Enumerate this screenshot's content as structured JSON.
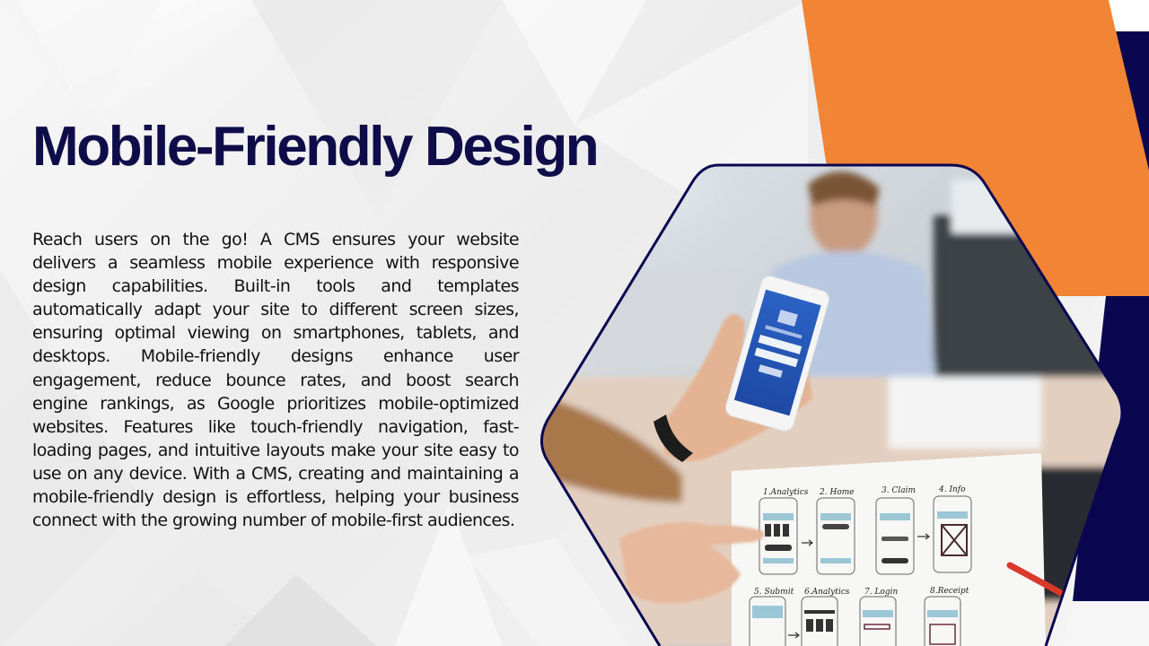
{
  "slide": {
    "title": "Mobile-Friendly Design",
    "body": "Reach users on the go! A CMS ensures your website delivers a seamless mobile experience with responsive design capabilities. Built-in tools and templates automatically adapt your site to different screen sizes, ensuring optimal viewing on smartphones, tablets, and desktops. Mobile-friendly designs enhance user engagement, reduce bounce rates, and boost search engine rankings, as Google prioritizes mobile-optimized websites. Features like touch-friendly navigation, fast-loading pages, and intuitive layouts make your site easy to use on any device. With a CMS, creating and maintaining a mobile-friendly design is effortless, helping your business connect with the growing number of mobile-first audiences."
  },
  "photo": {
    "description": "Person holding smartphone with login screen over hand-drawn app wireframe sketches",
    "sketch_labels": [
      "1.Analytics",
      "2. Home",
      "3. Claim",
      "4. Info",
      "5. Submit",
      "6.Analytics",
      "7. Login",
      "8.Receipt"
    ]
  },
  "colors": {
    "title": "#0f0c4a",
    "accent_orange": "#f18435",
    "accent_navy": "#0b0650",
    "body_text": "#111111"
  }
}
